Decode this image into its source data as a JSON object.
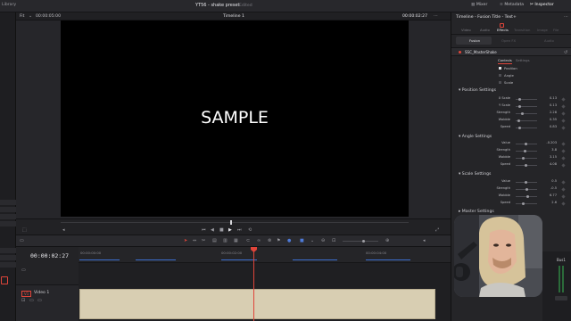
{
  "topbar": {
    "left_label": "Library",
    "project_title": "YT56 - shake preset",
    "project_status": "Edited",
    "mixer_label": "Mixer",
    "metadata_label": "Metadata",
    "inspector_label": "Inspector"
  },
  "viewer": {
    "zoom": "Fit",
    "timecode_left": "00:00:05:00",
    "timeline_name": "Timeline 1",
    "timecode_right": "00:00:02:27",
    "sample_text": "SAMPLE"
  },
  "timeline": {
    "timecode": "00:00:02:27",
    "ruler_marks": [
      "00:00:00:00",
      "00:00:02:00",
      "00:00:04:00"
    ],
    "track_name": "Video 1",
    "track_id": "V1"
  },
  "inspector": {
    "header": "Timeline - Fusion Title - Text+",
    "tabs": [
      "Video",
      "Audio",
      "Effects",
      "Transition",
      "Image",
      "File"
    ],
    "active_tab": "Effects",
    "subtabs": [
      "Fusion",
      "Open FX",
      "Audio"
    ],
    "tool_name": "SSC_MasterShake",
    "controls_tab": "Controls",
    "settings_tab": "Settings",
    "toggles": [
      "Position",
      "Angle",
      "Scale"
    ],
    "sections": {
      "position": {
        "title": "Position Settings",
        "rows": [
          {
            "label": "X Scale",
            "value": "0.13"
          },
          {
            "label": "Y Scale",
            "value": "0.13"
          },
          {
            "label": "Strength",
            "value": "2.28"
          },
          {
            "label": "Wobble",
            "value": "0.35"
          },
          {
            "label": "Speed",
            "value": "0.83"
          }
        ]
      },
      "angle": {
        "title": "Angle Settings",
        "rows": [
          {
            "label": "Value",
            "value": "-0.203"
          },
          {
            "label": "Strength",
            "value": "3.8"
          },
          {
            "label": "Wobble",
            "value": "3.15"
          },
          {
            "label": "Speed",
            "value": "4.08"
          }
        ]
      },
      "scale": {
        "title": "Scale Settings",
        "rows": [
          {
            "label": "Value",
            "value": "0.5"
          },
          {
            "label": "Strength",
            "value": "-0.5"
          },
          {
            "label": "Wobble",
            "value": "6.77"
          },
          {
            "label": "Speed",
            "value": "2.6"
          }
        ]
      },
      "master": {
        "title": "Master Settings"
      }
    }
  },
  "mixer": {
    "bus_label": "Bus1"
  },
  "colors": {
    "playhead": "#e0453a",
    "clip": "#d8ceb2",
    "accent": "#e0453a"
  }
}
